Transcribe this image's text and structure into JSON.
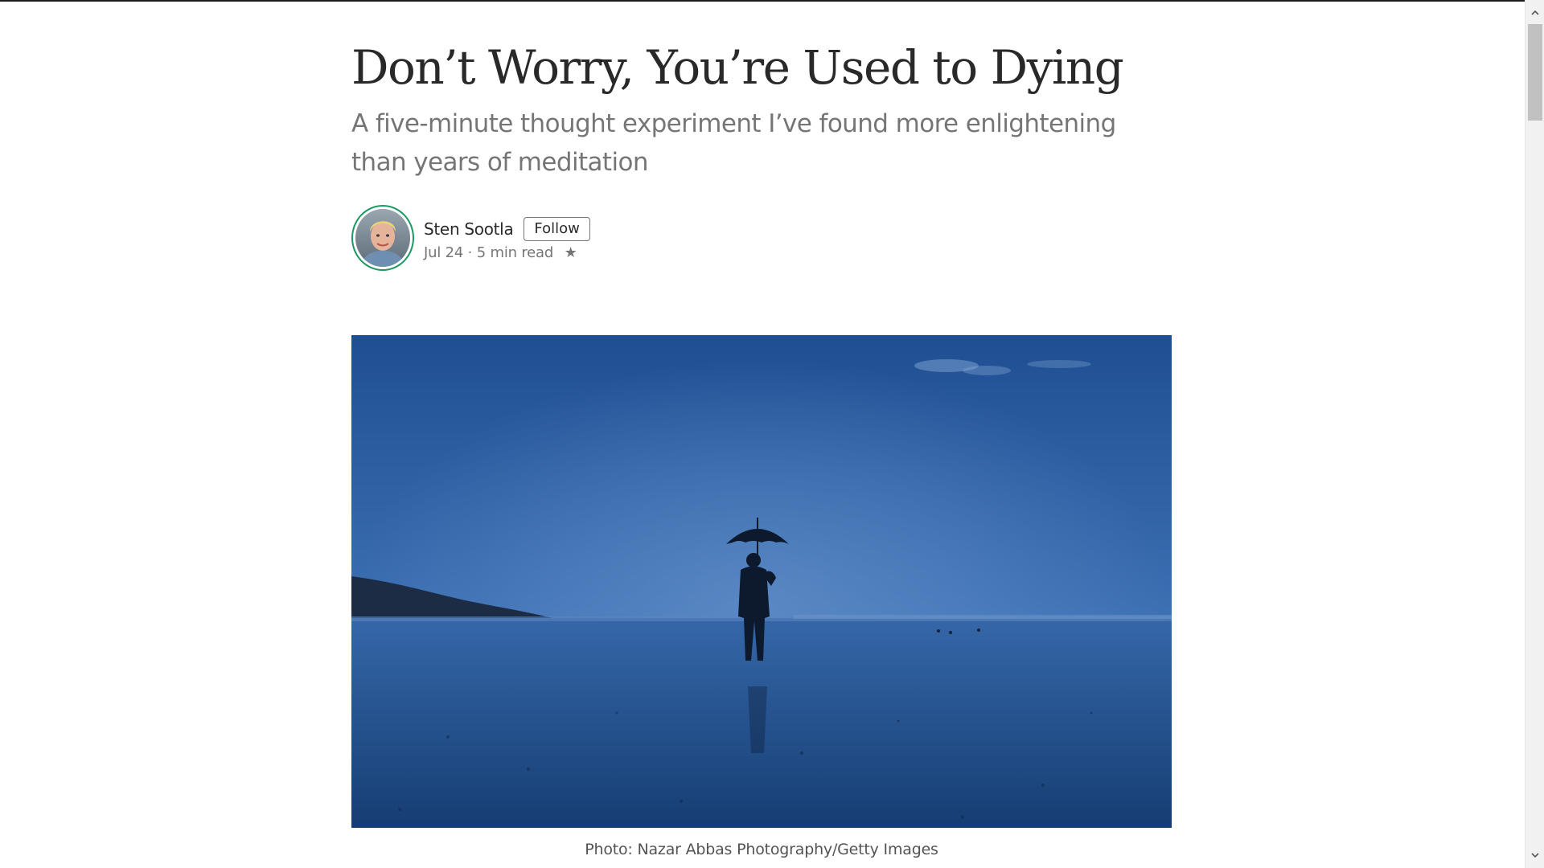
{
  "article": {
    "title": "Don’t Worry, You’re Used to Dying",
    "subtitle": "A five-minute thought experiment I’ve found more enlightening than years of meditation"
  },
  "byline": {
    "author": "Sten Sootla",
    "follow_label": "Follow",
    "meta": "Jul 24 · 5 min read",
    "star_icon": "★"
  },
  "figure": {
    "caption": "Photo: Nazar Abbas Photography/Getty Images",
    "alt": "Silhouette of a person with an umbrella standing on a wet beach at dusk"
  },
  "scrollbar": {
    "up_icon": "chevron-up-icon",
    "down_icon": "chevron-down-icon"
  },
  "colors": {
    "avatar_ring": "#1c9963",
    "photo_sky": "#2f5f9e",
    "photo_ground": "#1e4a86"
  }
}
